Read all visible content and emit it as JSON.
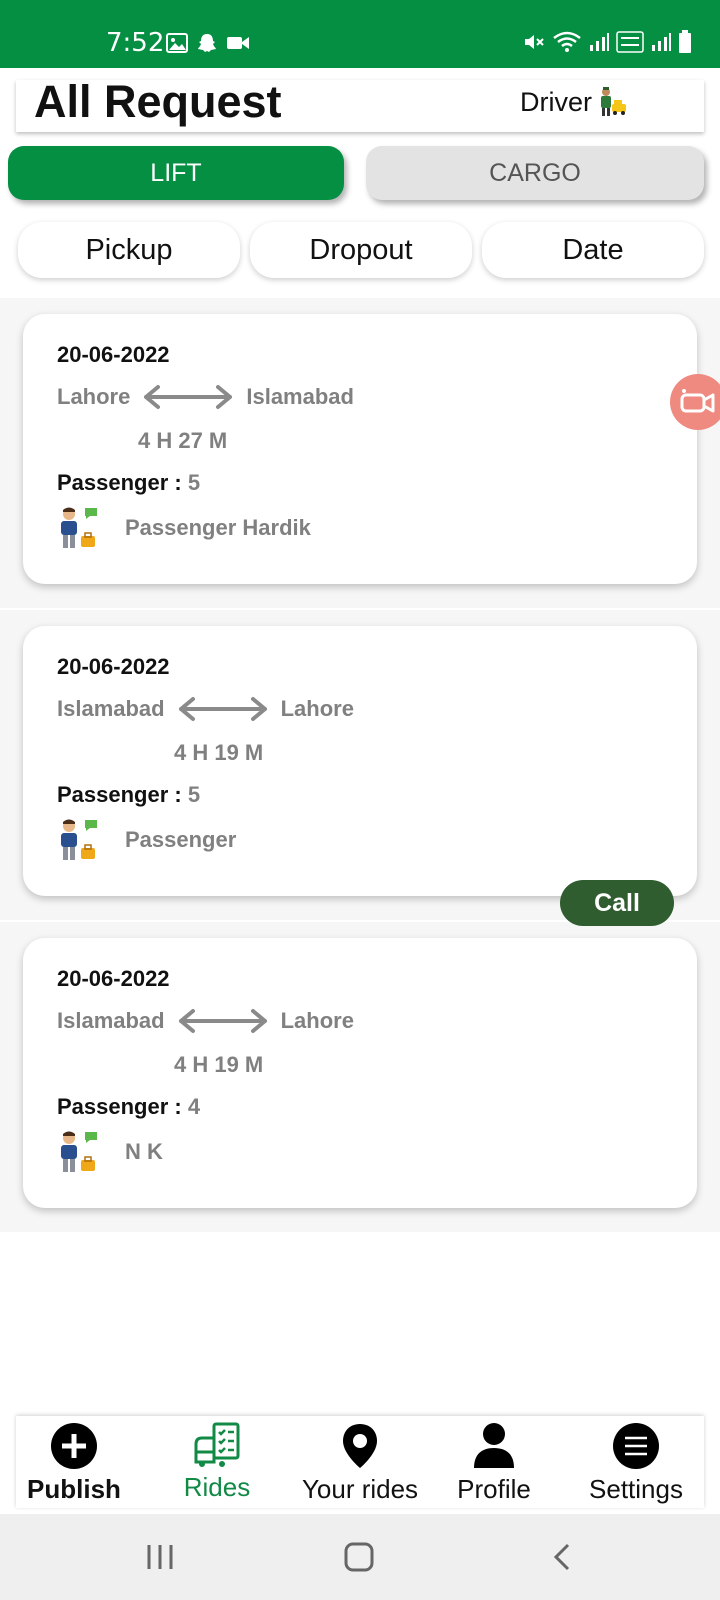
{
  "status_bar": {
    "time": "7:52"
  },
  "header": {
    "title": "All Request",
    "role_label": "Driver"
  },
  "tabs": {
    "lift_label": "LIFT",
    "cargo_label": "CARGO",
    "active": "LIFT"
  },
  "filters": {
    "pickup": "Pickup",
    "dropout": "Dropout",
    "date": "Date"
  },
  "requests": [
    {
      "date": "20-06-2022",
      "from": "Lahore",
      "to": "Islamabad",
      "duration": "4 H 27 M",
      "passenger_label": "Passenger : ",
      "passenger_count": "5",
      "passenger_name": "Passenger Hardik"
    },
    {
      "date": "20-06-2022",
      "from": "Islamabad",
      "to": "Lahore",
      "duration": "4 H 19 M",
      "passenger_label": "Passenger : ",
      "passenger_count": "5",
      "passenger_name": "Passenger"
    },
    {
      "date": "20-06-2022",
      "from": "Islamabad",
      "to": "Lahore",
      "duration": "4 H 19 M",
      "passenger_label": "Passenger : ",
      "passenger_count": "4",
      "passenger_name": "N K"
    }
  ],
  "call_button": {
    "label": "Call"
  },
  "bottom_nav": [
    {
      "label": "Publish",
      "icon": "plus-circle-icon"
    },
    {
      "label": "Rides",
      "icon": "rides-icon",
      "active": true
    },
    {
      "label": "Your rides",
      "icon": "location-pin-icon"
    },
    {
      "label": "Profile",
      "icon": "person-icon"
    },
    {
      "label": "Settings",
      "icon": "menu-circle-icon"
    }
  ],
  "colors": {
    "primary_green": "#048f42",
    "call_green": "#2f5d2f",
    "muted_text": "#808080",
    "float_button": "#ef8a80"
  }
}
